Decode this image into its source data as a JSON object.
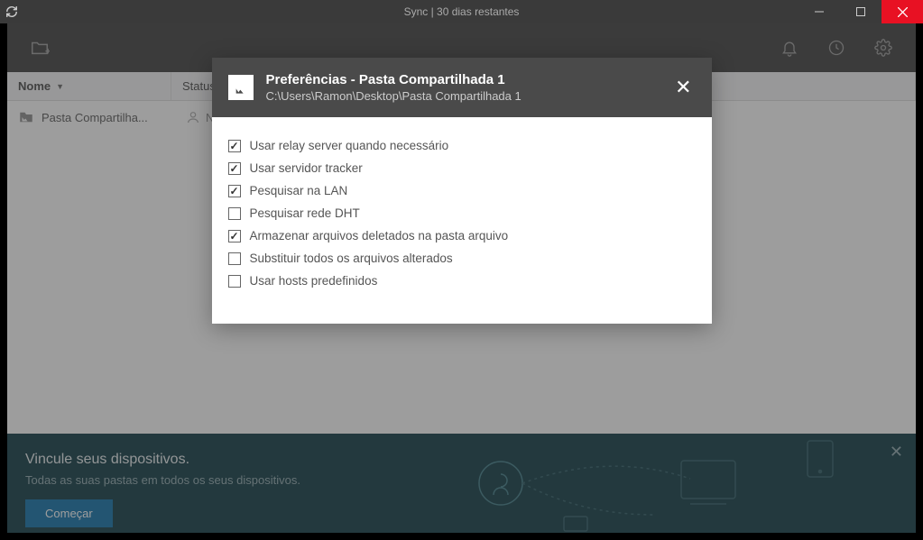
{
  "window": {
    "title": "Sync | 30 dias restantes"
  },
  "columns": {
    "name": "Nome",
    "status": "Status"
  },
  "rows": [
    {
      "name": "Pasta Compartilha...",
      "status_prefix": "N"
    }
  ],
  "banner": {
    "title": "Vincule seus dispositivos.",
    "subtitle": "Todas as suas pastas em todos os seus dispositivos.",
    "button": "Começar"
  },
  "modal": {
    "title": "Preferências - Pasta Compartilhada 1",
    "subtitle": "C:\\Users\\Ramon\\Desktop\\Pasta Compartilhada 1",
    "options": [
      {
        "label": "Usar relay server quando necessário",
        "checked": true
      },
      {
        "label": "Usar servidor tracker",
        "checked": true
      },
      {
        "label": "Pesquisar na LAN",
        "checked": true
      },
      {
        "label": "Pesquisar rede DHT",
        "checked": false
      },
      {
        "label": "Armazenar arquivos deletados na pasta arquivo",
        "checked": true
      },
      {
        "label": "Substituir todos os arquivos alterados",
        "checked": false
      },
      {
        "label": "Usar hosts predefinidos",
        "checked": false
      }
    ]
  }
}
